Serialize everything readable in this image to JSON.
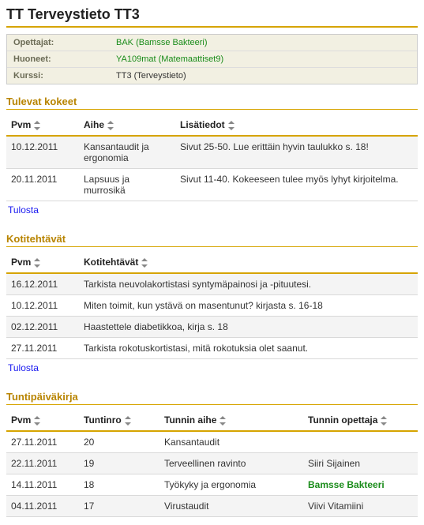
{
  "title": "TT Terveystieto TT3",
  "info": {
    "rows": [
      {
        "label": "Opettajat:",
        "value": "BAK (Bamsse Bakteeri)",
        "link": true
      },
      {
        "label": "Huoneet:",
        "value": "YA109mat (Matemaattiset9)",
        "link": true
      },
      {
        "label": "Kurssi:",
        "value": "TT3 (Terveystieto)",
        "link": false
      }
    ]
  },
  "exams": {
    "heading": "Tulevat kokeet",
    "headers": {
      "pvm": "Pvm",
      "aihe": "Aihe",
      "lisa": "Lisätiedot"
    },
    "rows": [
      {
        "pvm": "10.12.2011",
        "aihe": "Kansantaudit ja ergonomia",
        "lisa": "Sivut 25-50. Lue erittäin hyvin taulukko s. 18!"
      },
      {
        "pvm": "20.11.2011",
        "aihe": "Lapsuus ja murrosikä",
        "lisa": "Sivut 11-40. Kokeeseen tulee myös lyhyt kirjoitelma."
      }
    ],
    "print": "Tulosta"
  },
  "homework": {
    "heading": "Kotitehtävät",
    "headers": {
      "pvm": "Pvm",
      "task": "Kotitehtävät"
    },
    "rows": [
      {
        "pvm": "16.12.2011",
        "task": "Tarkista neuvolakortistasi syntymäpainosi ja -pituutesi."
      },
      {
        "pvm": "10.12.2011",
        "task": "Miten toimit, kun ystävä on masentunut? kirjasta s. 16-18"
      },
      {
        "pvm": "02.12.2011",
        "task": " Haastettele diabetikkoa, kirja s. 18"
      },
      {
        "pvm": "27.11.2011",
        "task": "Tarkista rokotuskortistasi, mitä rokotuksia olet saanut."
      }
    ],
    "print": "Tulosta"
  },
  "diary": {
    "heading": "Tuntipäiväkirja",
    "headers": {
      "pvm": "Pvm",
      "nro": "Tuntinro",
      "aihe": "Tunnin aihe",
      "op": "Tunnin opettaja"
    },
    "rows": [
      {
        "pvm": "27.11.2011",
        "nro": "20",
        "aihe": "Kansantaudit",
        "op": "",
        "opLink": false
      },
      {
        "pvm": "22.11.2011",
        "nro": "19",
        "aihe": "Terveellinen ravinto",
        "op": "Siiri Sijainen",
        "opLink": false
      },
      {
        "pvm": "14.11.2011",
        "nro": "18",
        "aihe": "Työkyky ja ergonomia",
        "op": "Bamsse Bakteeri",
        "opLink": true
      },
      {
        "pvm": "04.11.2011",
        "nro": "17",
        "aihe": "Virustaudit",
        "op": "Viivi Vitamiini",
        "opLink": false
      }
    ]
  }
}
